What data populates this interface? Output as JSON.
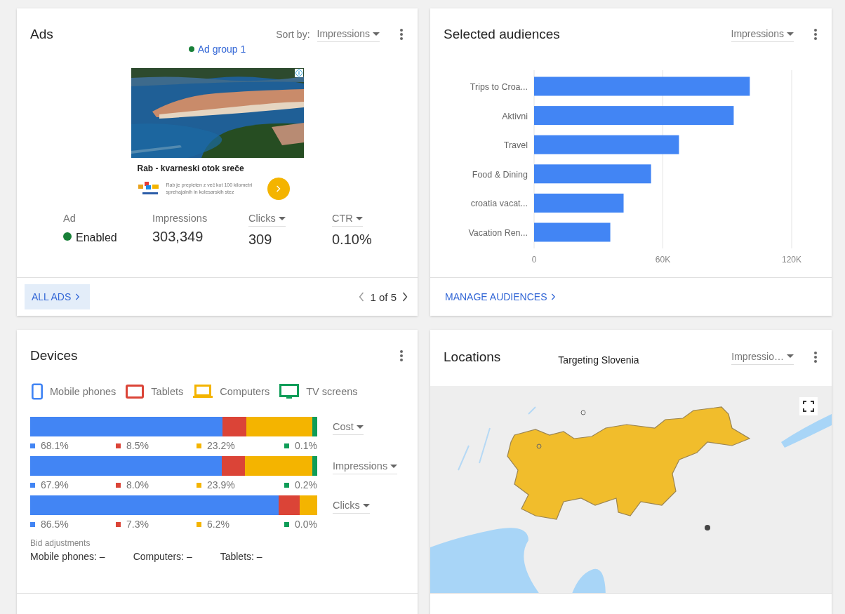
{
  "ads": {
    "title": "Ads",
    "sort_label": "Sort by:",
    "sort_value": "Impressions",
    "ad_group": {
      "label": "Ad group 1",
      "color": "#188038"
    },
    "ad": {
      "kind": "picture",
      "headline": "Rab - kvarneski otok sreče",
      "description": "Rab je prepleten z več kot 100 kilometri sprehajalnih in kolesarskih stez"
    },
    "stats": [
      {
        "label": "Ad",
        "dropdown": false,
        "value": "Enabled",
        "color": "#188038"
      },
      {
        "label": "Impressions",
        "dropdown": false,
        "value": "303,349"
      },
      {
        "label": "Clicks",
        "dropdown": true,
        "value": "309"
      },
      {
        "label": "CTR",
        "dropdown": true,
        "value": "0.10%"
      }
    ],
    "footer_button": "ALL ADS",
    "pager": "1 of 5"
  },
  "audiences": {
    "title": "Selected audiences",
    "metric": "Impressions",
    "footer_link": "MANAGE AUDIENCES",
    "chart_data": {
      "type": "bar",
      "orientation": "horizontal",
      "categories": [
        "Trips to Croa...",
        "Aktivni",
        "Travel",
        "Food & Dining",
        "croatia vacat...",
        "Vacation Ren..."
      ],
      "values": [
        100500,
        93000,
        67500,
        54500,
        41700,
        35500
      ],
      "xlim": [
        0,
        120000
      ],
      "xticks": [
        {
          "value": 0,
          "label": "0"
        },
        {
          "value": 60000,
          "label": "60K"
        },
        {
          "value": 120000,
          "label": "120K"
        }
      ]
    }
  },
  "devices": {
    "title": "Devices",
    "legend": [
      {
        "label": "Mobile phones",
        "kind": "phone",
        "color": "#4285f4"
      },
      {
        "label": "Tablets",
        "kind": "tablet",
        "color": "#db4437"
      },
      {
        "label": "Computers",
        "kind": "laptop",
        "color": "#f4b400"
      },
      {
        "label": "TV screens",
        "kind": "tv",
        "color": "#0f9d58"
      }
    ],
    "metrics": [
      {
        "label": "Cost",
        "segments": [
          "68.1%",
          "8.5%",
          "23.2%",
          "0.1%"
        ]
      },
      {
        "label": "Impressions",
        "segments": [
          "67.9%",
          "8.0%",
          "23.9%",
          "0.2%"
        ]
      },
      {
        "label": "Clicks",
        "segments": [
          "86.5%",
          "7.3%",
          "6.2%",
          "0.0%"
        ]
      }
    ],
    "bid_title": "Bid adjustments",
    "bids": [
      "Mobile phones: –",
      "Computers: –",
      "Tablets: –"
    ]
  },
  "locations": {
    "title": "Locations",
    "subtitle": "Targeting Slovenia",
    "metric": "Impressio…"
  }
}
